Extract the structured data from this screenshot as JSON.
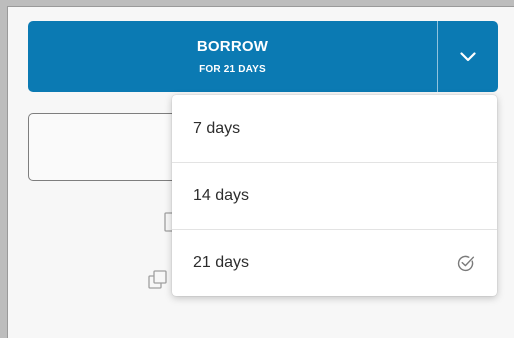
{
  "borrow": {
    "label": "BORROW",
    "duration_label": "FOR 21 DAYS",
    "toggle_icon": "chevron-down-icon"
  },
  "duration_menu": {
    "options": [
      {
        "label": "7 days",
        "selected": false
      },
      {
        "label": "14 days",
        "selected": false
      },
      {
        "label": "21 days",
        "selected": true
      }
    ],
    "selected_icon": "check-circle-icon"
  },
  "colors": {
    "primary": "#0b7ab3",
    "background": "#f7f7f7",
    "outer_frame": "#bdbdbd",
    "menu_background": "#ffffff",
    "text": "#2d2d2d"
  }
}
